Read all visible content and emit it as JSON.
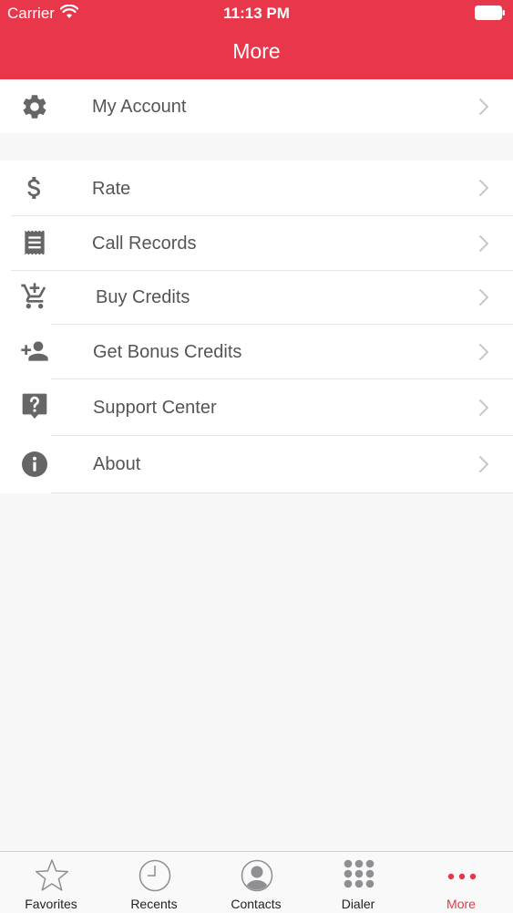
{
  "status_bar": {
    "carrier": "Carrier",
    "time": "11:13 PM"
  },
  "header": {
    "title": "More"
  },
  "menu": {
    "account": {
      "label": "My Account",
      "icon": "gear-icon"
    },
    "items": [
      {
        "label": "Rate",
        "icon": "dollar-icon"
      },
      {
        "label": "Call Records",
        "icon": "receipt-icon"
      },
      {
        "label": "Buy Credits",
        "icon": "cart-plus-icon"
      },
      {
        "label": "Get Bonus Credits",
        "icon": "person-add-icon"
      },
      {
        "label": "Support Center",
        "icon": "help-bubble-icon"
      },
      {
        "label": "About",
        "icon": "info-icon"
      }
    ]
  },
  "tabs": [
    {
      "label": "Favorites",
      "icon": "star-icon"
    },
    {
      "label": "Recents",
      "icon": "clock-icon"
    },
    {
      "label": "Contacts",
      "icon": "contact-icon"
    },
    {
      "label": "Dialer",
      "icon": "keypad-icon"
    },
    {
      "label": "More",
      "icon": "more-dots-icon",
      "active": true
    }
  ],
  "colors": {
    "accent": "#e8374a",
    "icon": "#666666",
    "label": "#555555",
    "chevron": "#c7c7cc"
  }
}
